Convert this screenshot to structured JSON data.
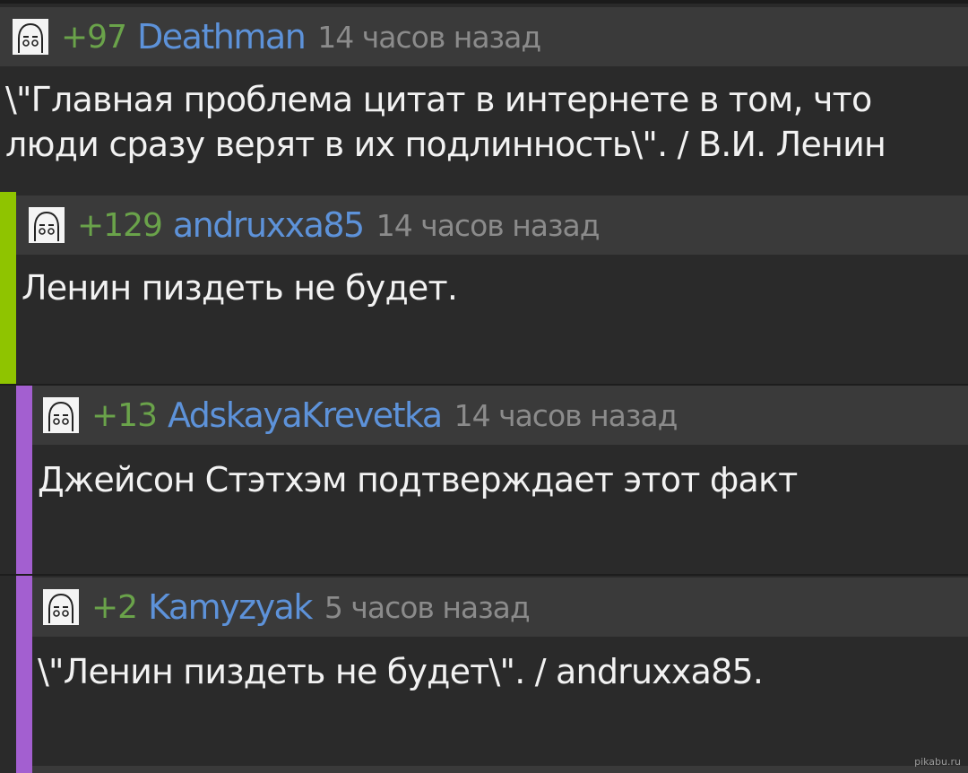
{
  "accent_colors": {
    "level1_bar": "#8fc400",
    "level2_bar": "#a35fd0",
    "rating": "#6aa34a",
    "author": "#5d92d9"
  },
  "comments": [
    {
      "rating": "+97",
      "author": "Deathman",
      "time": "14 часов назад",
      "text": "\\\"Главная проблема цитат в интернете в том, что люди сразу верят в их подлинность\\\". / В.И. Ленин",
      "avatar_icon": "avatar-face-icon"
    },
    {
      "rating": "+129",
      "author": "andruxxa85",
      "time": "14 часов назад",
      "text": "Ленин пиздеть не будет.",
      "avatar_icon": "avatar-face-icon"
    },
    {
      "rating": "+13",
      "author": "AdskayaKrevetka",
      "time": "14 часов назад",
      "text": "Джейсон Стэтхэм подтверждает этот факт",
      "avatar_icon": "avatar-face-icon"
    },
    {
      "rating": "+2",
      "author": "Kamyzyak",
      "time": "5 часов назад",
      "text": "\\\"Ленин пиздеть не будет\\\". / andruxxa85.",
      "avatar_icon": "avatar-face-icon"
    }
  ],
  "watermark": "pikabu.ru"
}
